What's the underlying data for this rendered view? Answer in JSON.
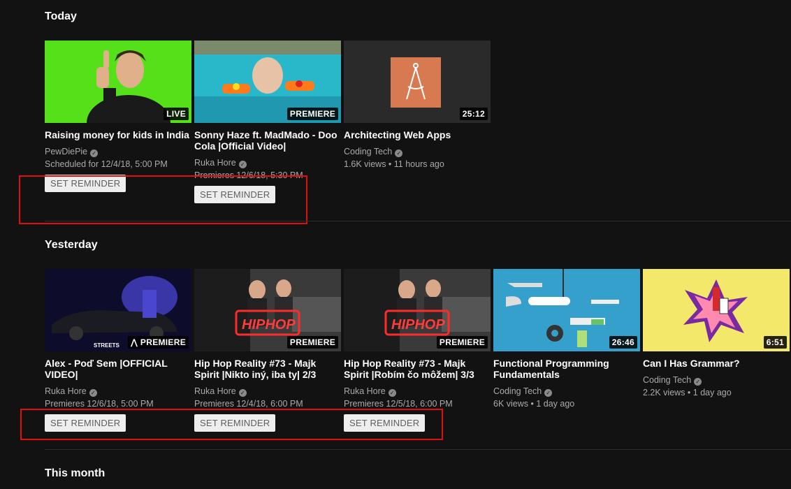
{
  "sections": {
    "today": "Today",
    "yesterday": "Yesterday",
    "this_month": "This month"
  },
  "today_videos": [
    {
      "title": "Raising money for kids in India",
      "channel": "PewDiePie",
      "meta": "Scheduled for 12/4/18, 5:00 PM",
      "badge": "LIVE",
      "button": "SET REMINDER"
    },
    {
      "title": "Sonny Haze ft. MadMado - Doo Cola |Official Video|",
      "channel": "Ruka Hore",
      "meta": "Premieres 12/6/18, 5:30 PM",
      "badge": "PREMIERE",
      "button": "SET REMINDER"
    },
    {
      "title": "Architecting Web Apps",
      "channel": "Coding Tech",
      "meta": "1.6K views • 11 hours ago",
      "badge": "25:12"
    }
  ],
  "yesterday_videos": [
    {
      "title": "Alex - Poď Sem |OFFICIAL VIDEO|",
      "channel": "Ruka Hore",
      "meta": "Premieres 12/6/18, 5:00 PM",
      "badge": "PREMIERE",
      "button": "SET REMINDER",
      "thumb_text": "STREETS"
    },
    {
      "title": "Hip Hop Reality #73 - Majk Spirit |Nikto iný, iba ty| 2/3",
      "channel": "Ruka Hore",
      "meta": "Premieres 12/4/18, 6:00 PM",
      "badge": "PREMIERE",
      "button": "SET REMINDER",
      "thumb_text": "HIPHOP"
    },
    {
      "title": "Hip Hop Reality #73 - Majk Spirit |Robím čo môžem| 3/3",
      "channel": "Ruka Hore",
      "meta": "Premieres 12/5/18, 6:00 PM",
      "badge": "PREMIERE",
      "button": "SET REMINDER",
      "thumb_text": "HIPHOP"
    },
    {
      "title": "Functional Programming Fundamentals",
      "channel": "Coding Tech",
      "meta": "6K views • 1 day ago",
      "badge": "26:46"
    },
    {
      "title": "Can I Has Grammar?",
      "channel": "Coding Tech",
      "meta": "2.2K views • 1 day ago",
      "badge": "6:51"
    }
  ],
  "colors": {
    "background": "#121212",
    "highlight": "#e01010",
    "reminder_bg": "#eeeeee"
  }
}
